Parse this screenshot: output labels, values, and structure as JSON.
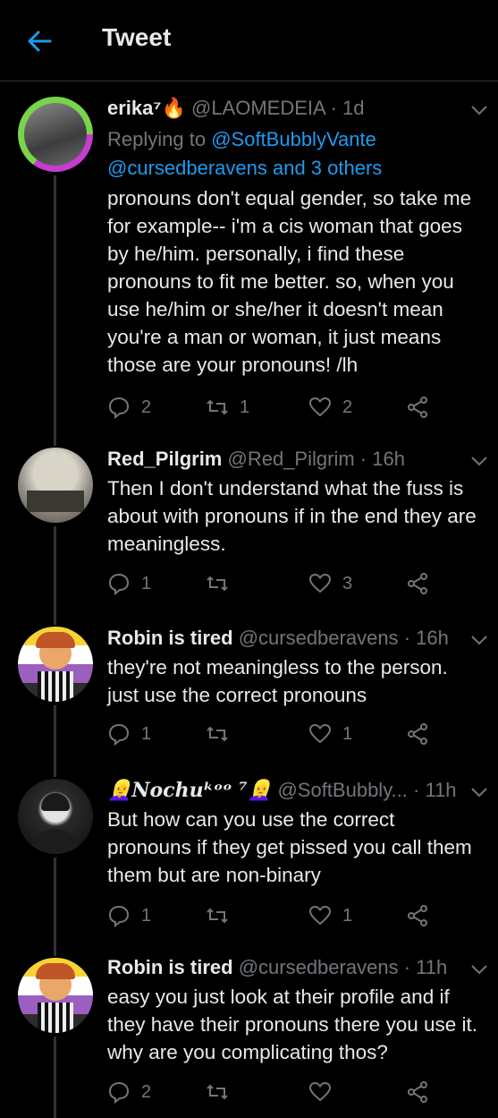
{
  "header": {
    "title": "Tweet"
  },
  "tweets": [
    {
      "name": "erika⁷🔥",
      "handle": "@LAOMEDEIA",
      "time": "· 1d",
      "replying_label": "Replying to",
      "replying_users": "@SoftBubblyVante",
      "replying_more": "@cursedberavens and 3 others",
      "text": "pronouns don't equal gender, so take me for example-- i'm a cis woman that goes by he/him. personally, i find these pronouns to fit me better. so, when you use he/him or she/her it doesn't mean you're a man or woman, it just means those are your pronouns! /lh",
      "replies": "2",
      "retweets": "1",
      "likes": "2"
    },
    {
      "name": "Red_Pilgrim",
      "handle": "@Red_Pilgrim",
      "time": "· 16h",
      "text": "Then I don't understand what the fuss is about with pronouns if in the end they are meaningless.",
      "replies": "1",
      "retweets": "",
      "likes": "3"
    },
    {
      "name": "Robin is tired",
      "handle": "@cursedberavens",
      "time": "· 16h",
      "text": "they're not meaningless to the person. just use the correct pronouns",
      "replies": "1",
      "retweets": "",
      "likes": "1"
    },
    {
      "name": "👱‍♀️𝑵𝒐𝒄𝒉𝒖ᵏᵒᵒ ⁷👱‍♀️",
      "handle": "@SoftBubbly...",
      "time": "· 11h",
      "text": "But how can you use the correct pronouns if they get pissed you call them them but are non-binary",
      "replies": "1",
      "retweets": "",
      "likes": "1"
    },
    {
      "name": "Robin is tired",
      "handle": "@cursedberavens",
      "time": "· 11h",
      "text": "easy you just look at their profile and if they have their pronouns there you use it. why are you complicating thos?",
      "replies": "2",
      "retweets": "",
      "likes": ""
    }
  ]
}
